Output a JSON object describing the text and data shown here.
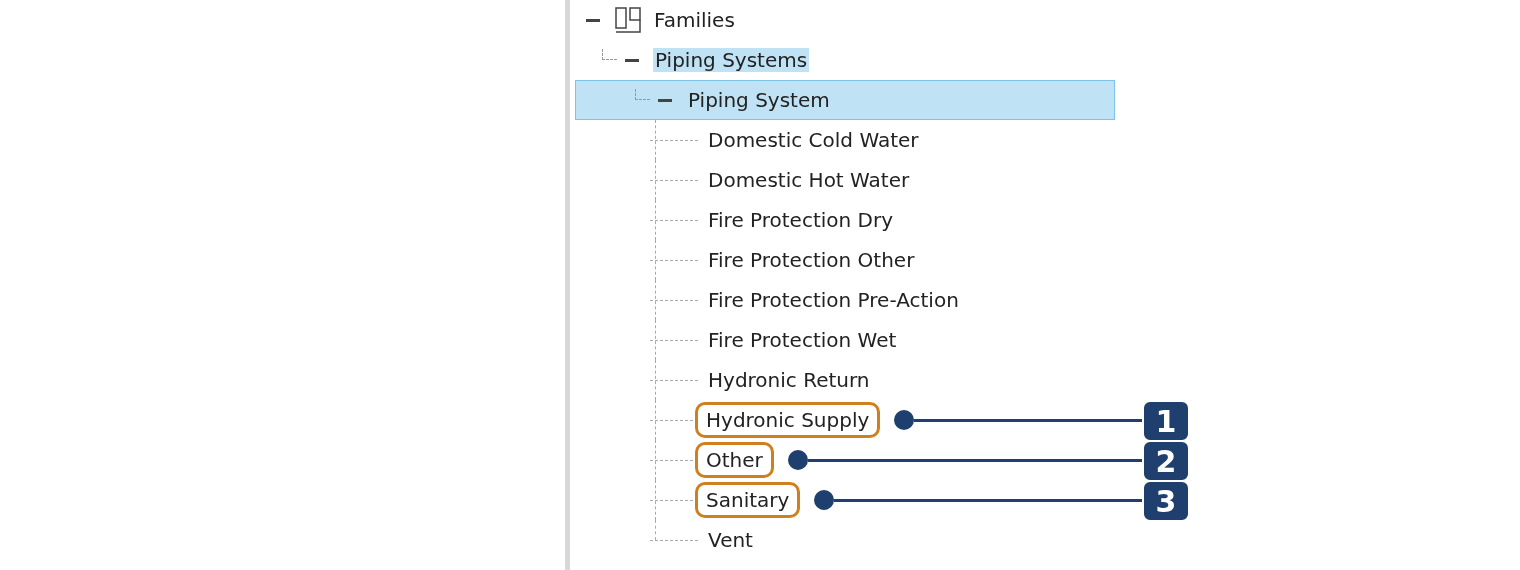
{
  "tree": [
    {
      "label": "Families",
      "expanded": true,
      "selected": false,
      "highlighted": false,
      "children": [
        {
          "label": "Piping Systems",
          "expanded": true,
          "selected": false,
          "highlighted": true,
          "children": [
            {
              "label": "Piping System",
              "expanded": true,
              "selected": true,
              "highlighted": false,
              "children": [
                {
                  "label": "Domestic Cold Water",
                  "outlined": false
                },
                {
                  "label": "Domestic Hot Water",
                  "outlined": false
                },
                {
                  "label": "Fire Protection Dry",
                  "outlined": false
                },
                {
                  "label": "Fire Protection Other",
                  "outlined": false
                },
                {
                  "label": "Fire Protection Pre-Action",
                  "outlined": false
                },
                {
                  "label": "Fire Protection Wet",
                  "outlined": false
                },
                {
                  "label": "Hydronic Return",
                  "outlined": false
                },
                {
                  "label": "Hydronic Supply",
                  "outlined": true,
                  "callout": "1"
                },
                {
                  "label": "Other",
                  "outlined": true,
                  "callout": "2"
                },
                {
                  "label": "Sanitary",
                  "outlined": true,
                  "callout": "3"
                },
                {
                  "label": "Vent",
                  "outlined": false
                }
              ]
            }
          ]
        }
      ]
    }
  ]
}
